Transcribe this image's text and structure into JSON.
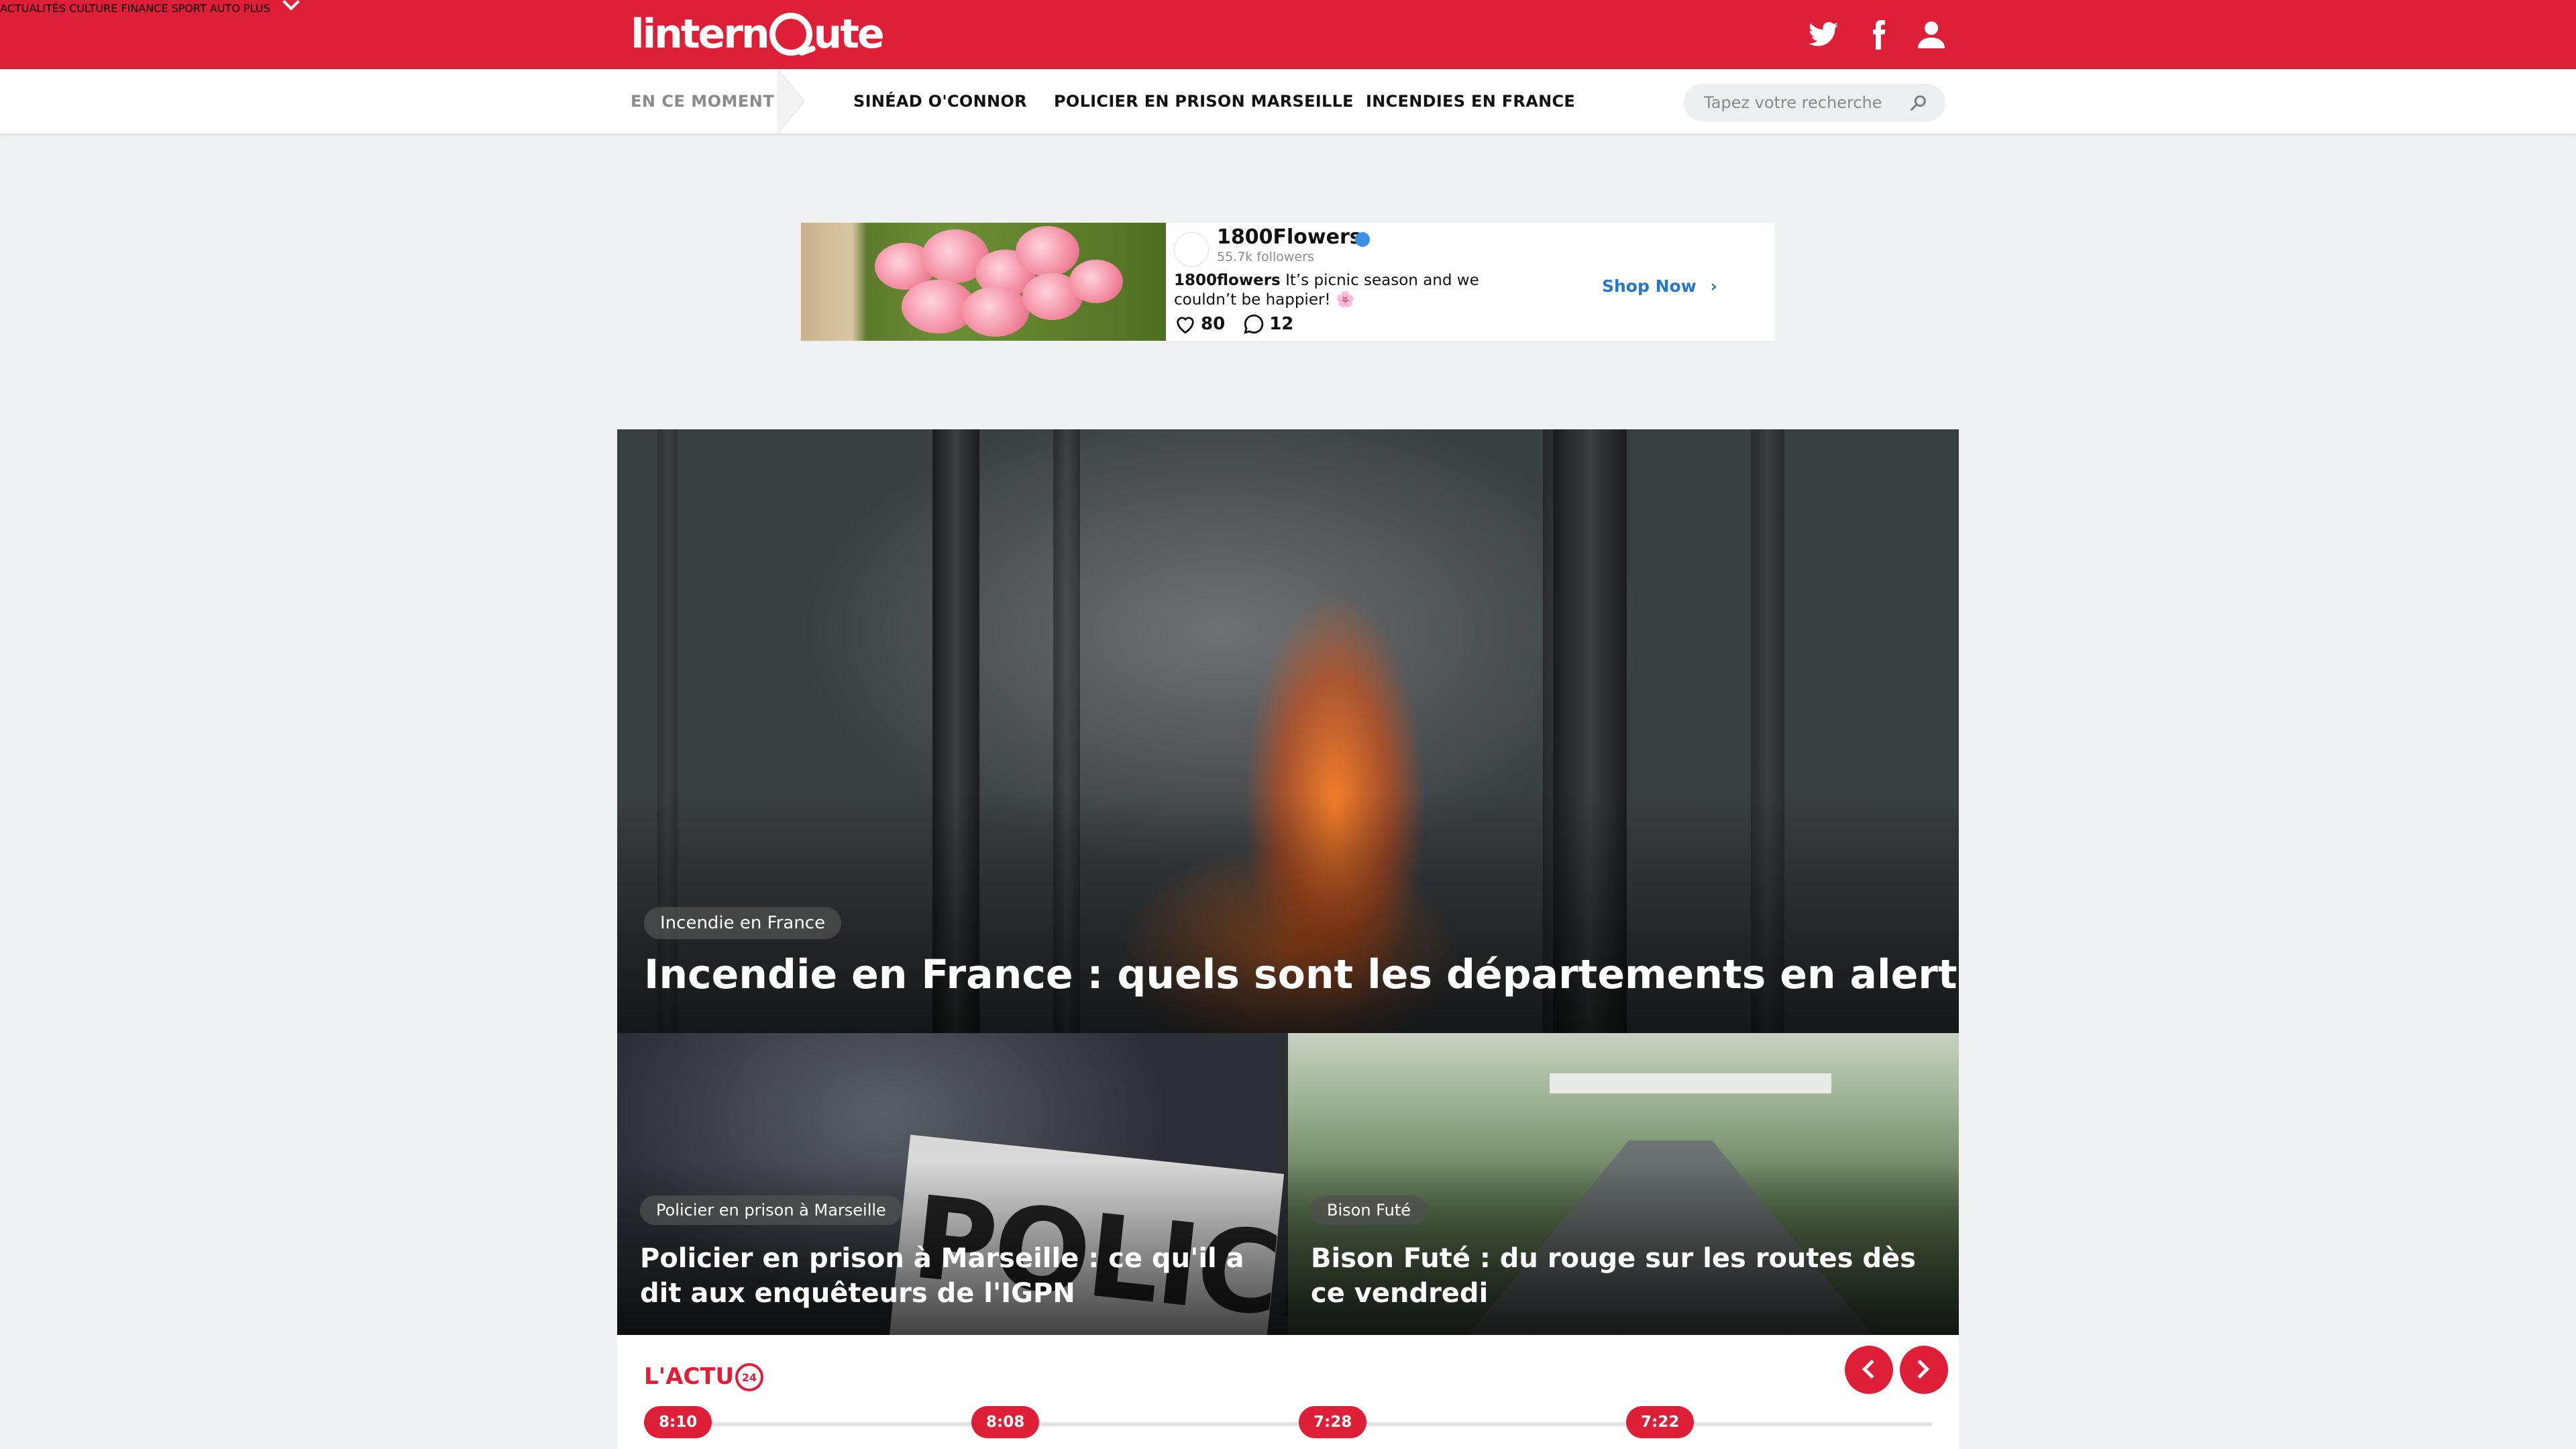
{
  "header": {
    "logo_text": "linternaute",
    "nav": [
      "ACTUALITÉS",
      "CULTURE",
      "FINANCE",
      "SPORT",
      "AUTO",
      "PLUS"
    ],
    "brand_color": "#de1f38"
  },
  "subbar": {
    "label": "EN CE MOMENT",
    "trends": [
      "SINÉAD O'CONNOR",
      "POLICIER EN PRISON MARSEILLE",
      "INCENDIES EN FRANCE"
    ],
    "search_placeholder": "Tapez votre recherche"
  },
  "ad": {
    "brand": "1800Flowers",
    "followers": "55.7k followers",
    "handle": "1800flowers",
    "text": "It’s picnic season and we couldn’t be happier! 🌸",
    "likes": "80",
    "comments": "12",
    "cta": "Shop Now"
  },
  "hero": {
    "tag": "Incendie en France",
    "title": "Incendie en France : quels sont les départements en alerte ?"
  },
  "cards": [
    {
      "tag": "Policier en prison à Marseille",
      "title": "Policier en prison à Marseille : ce qu'il a dit aux enquêteurs de l'IGPN"
    },
    {
      "tag": "Bison Futé",
      "title": "Bison Futé : du rouge sur les routes dès ce vendredi"
    }
  ],
  "actu": {
    "title": "L'ACTU",
    "times": [
      "8:10",
      "8:08",
      "7:28",
      "7:22"
    ]
  }
}
